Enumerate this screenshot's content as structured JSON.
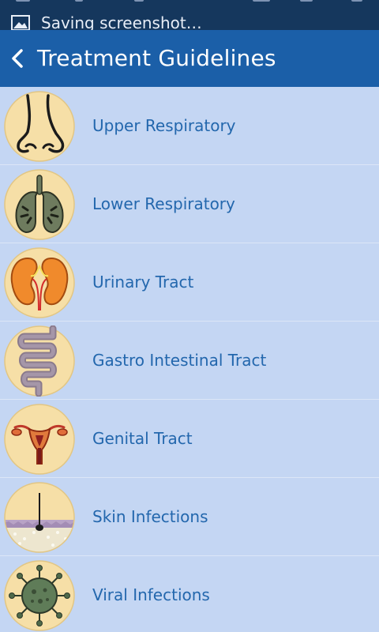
{
  "status_bar": {
    "notification_text": "Saving screenshot…",
    "notification_icon": "image-icon"
  },
  "header": {
    "title": "Treatment Guidelines",
    "back_icon": "chevron-left-icon"
  },
  "colors": {
    "status_bar_bg": "#15375d",
    "header_bg": "#1b5fa8",
    "list_bg": "#c4d6f3",
    "label_text": "#2367ad",
    "icon_circle": "#f6dfa7"
  },
  "categories": [
    {
      "label": "Upper Respiratory",
      "icon": "nose-icon"
    },
    {
      "label": "Lower Respiratory",
      "icon": "lungs-icon"
    },
    {
      "label": "Urinary Tract",
      "icon": "kidneys-icon"
    },
    {
      "label": "Gastro Intestinal Tract",
      "icon": "intestine-icon"
    },
    {
      "label": "Genital Tract",
      "icon": "uterus-icon"
    },
    {
      "label": "Skin Infections",
      "icon": "skin-layers-icon"
    },
    {
      "label": "Viral Infections",
      "icon": "virus-icon"
    }
  ]
}
